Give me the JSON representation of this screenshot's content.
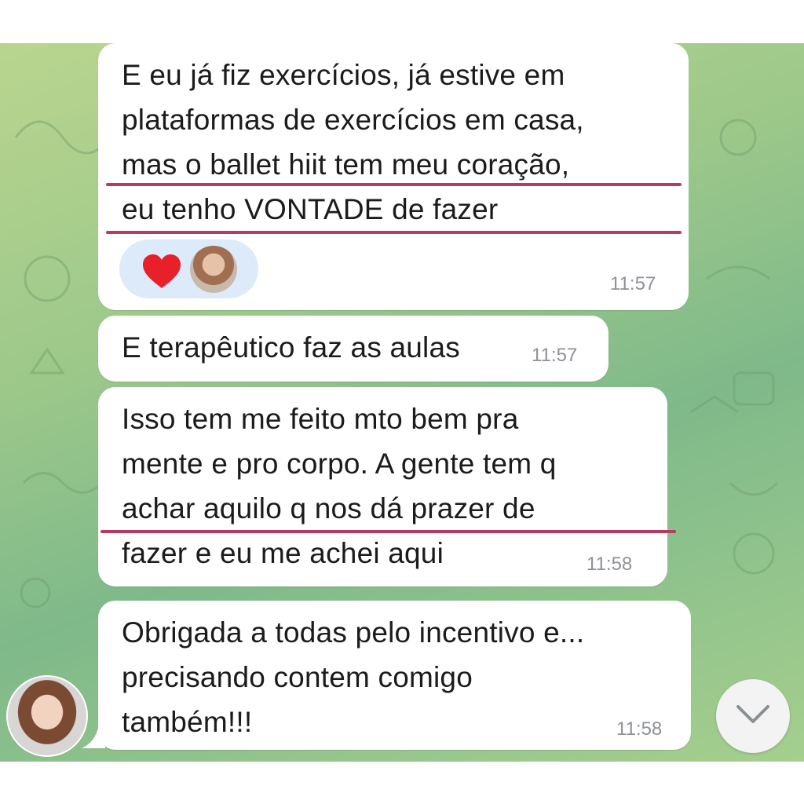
{
  "messages": [
    {
      "text": "E eu já fiz exercícios, já estive em\nplataformas de exercícios em casa,\nmas o ballet hiit tem meu coração,\neu tenho VONTADE de fazer",
      "time": "11:57",
      "reactions": [
        "heart-emoji",
        "avatar"
      ]
    },
    {
      "text": "E terapêutico faz as aulas",
      "time": "11:57"
    },
    {
      "text": "Isso tem me feito mto bem pra\nmente e pro corpo. A gente tem q\nachar aquilo q nos dá prazer de\nfazer e eu me achei aqui",
      "time": "11:58"
    },
    {
      "text": "Obrigada a todas pelo incentivo e...\nprecisando contem comigo\ntambém!!!",
      "time": "11:58"
    }
  ],
  "colors": {
    "underline": "#b63a64",
    "bubble": "#ffffff",
    "reaction_bg": "#ddeaf9",
    "heart": "#e8202a"
  },
  "icons": [
    "heart-icon",
    "chevron-down-icon"
  ]
}
